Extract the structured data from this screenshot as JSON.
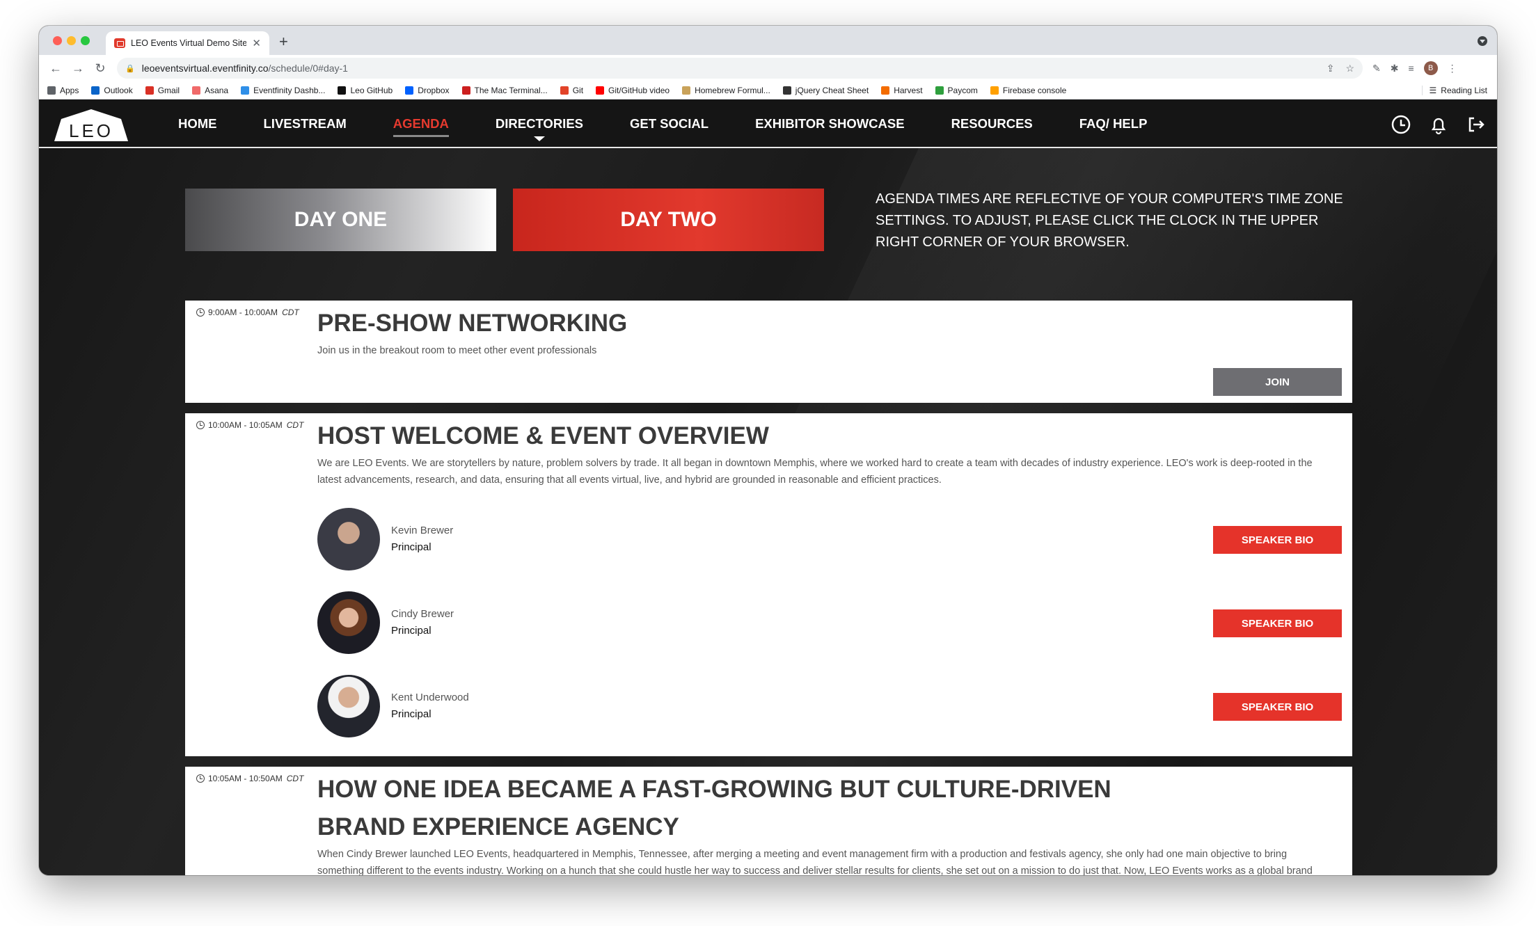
{
  "browser": {
    "tab_title": "LEO Events Virtual Demo Site",
    "url_domain": "leoeventsvirtual.eventfinity.co",
    "url_path": "/schedule/0#day-1",
    "profile_initial": "B",
    "bookmarks": [
      {
        "label": "Apps",
        "color": "#5f6368"
      },
      {
        "label": "Outlook",
        "color": "#0a64c9"
      },
      {
        "label": "Gmail",
        "color": "#d93025"
      },
      {
        "label": "Asana",
        "color": "#f06a6a"
      },
      {
        "label": "Eventfinity Dashb...",
        "color": "#2f8fe8"
      },
      {
        "label": "Leo GitHub",
        "color": "#111111"
      },
      {
        "label": "Dropbox",
        "color": "#0061fe"
      },
      {
        "label": "The Mac Terminal...",
        "color": "#cc1f1f"
      },
      {
        "label": "Git",
        "color": "#e24329"
      },
      {
        "label": "Git/GitHub video",
        "color": "#ff0000"
      },
      {
        "label": "Homebrew Formul...",
        "color": "#c9a25a"
      },
      {
        "label": "jQuery Cheat Sheet",
        "color": "#333333"
      },
      {
        "label": "Harvest",
        "color": "#f36c00"
      },
      {
        "label": "Paycom",
        "color": "#2e9f3d"
      },
      {
        "label": "Firebase console",
        "color": "#ffa000"
      }
    ],
    "reading_list": "Reading List"
  },
  "site": {
    "logo_text": "LEO",
    "nav": [
      {
        "label": "HOME",
        "active": false
      },
      {
        "label": "LIVESTREAM",
        "active": false
      },
      {
        "label": "AGENDA",
        "active": true
      },
      {
        "label": "DIRECTORIES",
        "active": false,
        "dropdown": true
      },
      {
        "label": "GET SOCIAL",
        "active": false
      },
      {
        "label": "EXHIBITOR SHOWCASE",
        "active": false
      },
      {
        "label": "RESOURCES",
        "active": false
      },
      {
        "label": "FAQ/ HELP",
        "active": false
      }
    ],
    "accent_color": "#e5332a"
  },
  "agenda": {
    "day_one_label": "DAY ONE",
    "day_two_label": "DAY TWO",
    "timezone_note": "AGENDA TIMES ARE REFLECTIVE OF YOUR COMPUTER'S TIME ZONE SETTINGS. TO ADJUST, PLEASE CLICK THE CLOCK IN THE UPPER RIGHT CORNER OF YOUR BROWSER.",
    "sessions": [
      {
        "time": "9:00AM - 10:00AM",
        "tz": "CDT",
        "title": "PRE-SHOW NETWORKING",
        "description": "Join us in the breakout room to meet other event professionals",
        "button": "JOIN"
      },
      {
        "time": "10:00AM - 10:05AM",
        "tz": "CDT",
        "title": "HOST WELCOME & EVENT OVERVIEW",
        "description": "We are LEO Events. We are storytellers by nature, problem solvers by trade. It all began in downtown Memphis, where we worked hard to create a team with decades of industry experience. LEO's work is deep-rooted in the latest advancements, research, and data, ensuring that all events virtual, live, and hybrid are grounded in reasonable and efficient practices.",
        "speakers": [
          {
            "name": "Kevin Brewer",
            "role": "Principal",
            "button": "SPEAKER BIO"
          },
          {
            "name": "Cindy Brewer",
            "role": "Principal",
            "button": "SPEAKER BIO"
          },
          {
            "name": "Kent Underwood",
            "role": "Principal",
            "button": "SPEAKER BIO"
          }
        ]
      },
      {
        "time": "10:05AM - 10:50AM",
        "tz": "CDT",
        "title": "HOW ONE IDEA BECAME A FAST-GROWING BUT CULTURE-DRIVEN BRAND EXPERIENCE AGENCY",
        "description": "When Cindy Brewer launched LEO Events, headquartered in Memphis, Tennessee, after merging a meeting and event management firm with a production and festivals agency, she only had one main objective to bring something different to the events industry. Working on a hunch that she could hustle her way to success and deliver stellar results for clients, she set out on a mission to do just that. Now, LEO Events works as a global brand experience agency, serving a diverse client base including Walmart, AutoZone, and ExxonMobil, among many others. Over the years, LEO has seen exponential growth, but Cindy is"
      }
    ]
  }
}
